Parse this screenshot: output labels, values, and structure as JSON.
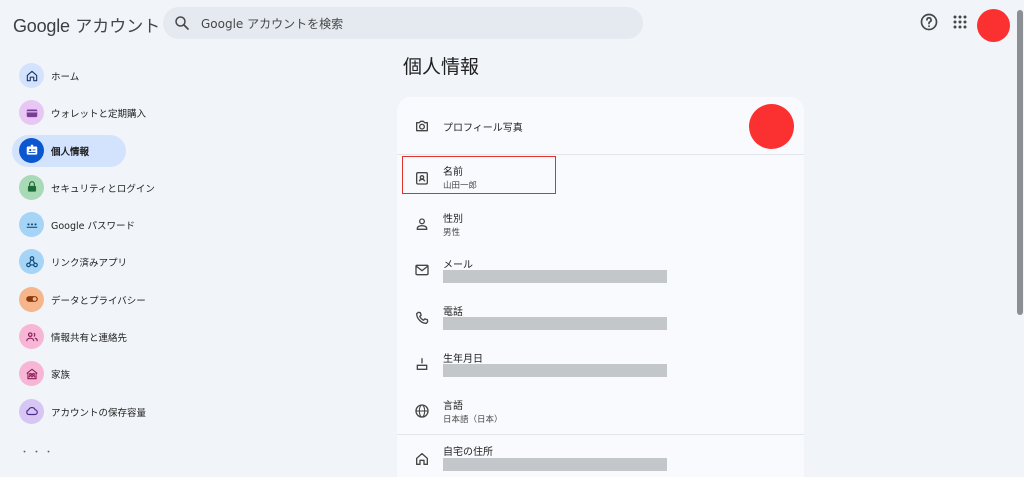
{
  "header": {
    "logo_google": "Google",
    "logo_suffix": "アカウント",
    "search_placeholder": "Google アカウントを検索"
  },
  "sidebar": {
    "items": [
      {
        "label": "ホーム",
        "icon": "home-icon",
        "color": "#d3e3fd"
      },
      {
        "label": "ウォレットと定期購入",
        "icon": "wallet-icon",
        "color": "#e8c7f5"
      },
      {
        "label": "個人情報",
        "icon": "id-card-icon",
        "color": "#0b57d0",
        "active": true
      },
      {
        "label": "セキュリティとログイン",
        "icon": "lock-icon",
        "color": "#a8dab5"
      },
      {
        "label": "Google パスワード",
        "icon": "password-icon",
        "color": "#a6d4f7"
      },
      {
        "label": "リンク済みアプリ",
        "icon": "linked-apps-icon",
        "color": "#a6d4f7"
      },
      {
        "label": "データとプライバシー",
        "icon": "toggle-icon",
        "color": "#f6b58a"
      },
      {
        "label": "情報共有と連絡先",
        "icon": "people-icon",
        "color": "#f7b6d6"
      },
      {
        "label": "家族",
        "icon": "family-icon",
        "color": "#f7b6d6"
      },
      {
        "label": "アカウントの保存容量",
        "icon": "cloud-icon",
        "color": "#d7c6f3"
      }
    ],
    "more_label": "・・・"
  },
  "main": {
    "title": "個人情報",
    "rows": {
      "photo": {
        "label": "プロフィール写真",
        "icon": "camera-icon"
      },
      "name": {
        "label": "名前",
        "value": "山田一郎",
        "icon": "badge-icon"
      },
      "gender": {
        "label": "性別",
        "value": "男性",
        "icon": "person-icon"
      },
      "email": {
        "label": "メール",
        "icon": "mail-icon"
      },
      "phone": {
        "label": "電話",
        "icon": "phone-icon"
      },
      "birthday": {
        "label": "生年月日",
        "icon": "cake-icon"
      },
      "language": {
        "label": "言語",
        "value": "日本語（日本）",
        "icon": "globe-icon"
      },
      "address": {
        "label": "自宅の住所",
        "icon": "home-icon"
      }
    }
  },
  "colors": {
    "background": "#f1f4f9",
    "card": "#f8fafd",
    "avatar": "#fb3131",
    "highlight_border": "#e0322a",
    "active_nav": "#d3e3fd"
  }
}
